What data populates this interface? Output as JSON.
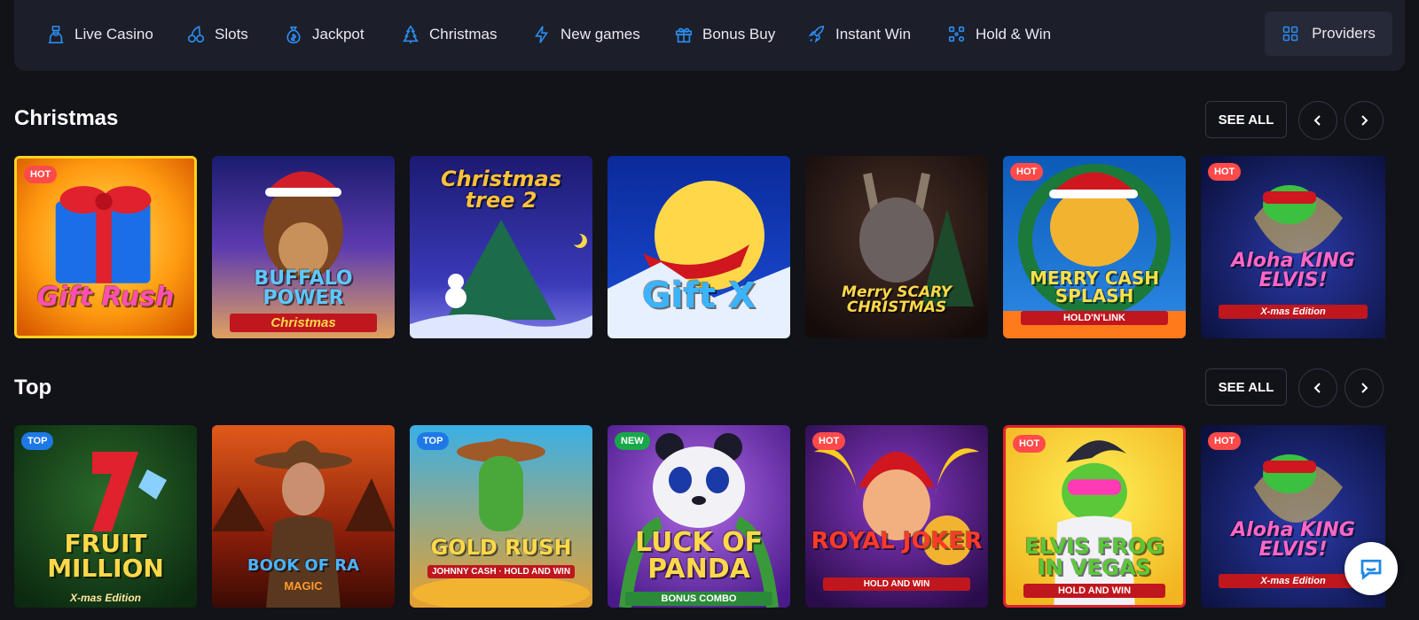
{
  "nav": {
    "items": [
      {
        "label": "Live Casino",
        "icon": "dealer-icon"
      },
      {
        "label": "Slots",
        "icon": "cherries-icon"
      },
      {
        "label": "Jackpot",
        "icon": "money-bag-icon"
      },
      {
        "label": "Christmas",
        "icon": "christmas-tree-icon"
      },
      {
        "label": "New games",
        "icon": "lightning-icon"
      },
      {
        "label": "Bonus Buy",
        "icon": "gift-icon"
      },
      {
        "label": "Instant Win",
        "icon": "rocket-icon"
      },
      {
        "label": "Hold & Win",
        "icon": "grid-dots-icon"
      }
    ],
    "providers_label": "Providers"
  },
  "colors": {
    "accent": "#1e88e5",
    "background": "#121219",
    "nav_bg": "#1c1e29",
    "hot": "#ff4a4a",
    "top": "#1e78e6",
    "new": "#18a84a"
  },
  "sections": [
    {
      "title": "Christmas",
      "see_all": "SEE ALL",
      "games": [
        {
          "title": "Gift Rush",
          "subtitle": "",
          "badge": "HOT"
        },
        {
          "title": "BUFFALO POWER",
          "subtitle": "Christmas",
          "badge": ""
        },
        {
          "title": "Christmas tree 2",
          "subtitle": "",
          "badge": ""
        },
        {
          "title": "Gift X",
          "subtitle": "",
          "badge": ""
        },
        {
          "title": "Merry SCARY CHRISTMAS",
          "subtitle": "",
          "badge": ""
        },
        {
          "title": "MERRY CASH SPLASH",
          "subtitle": "HOLD'N'LINK",
          "badge": "HOT"
        },
        {
          "title": "Aloha KING ELVIS!",
          "subtitle": "X-mas Edition",
          "badge": "HOT"
        }
      ]
    },
    {
      "title": "Top",
      "see_all": "SEE ALL",
      "games": [
        {
          "title": "FRUIT MILLION",
          "subtitle": "X-mas Edition",
          "badge": "TOP"
        },
        {
          "title": "BOOK OF RA",
          "subtitle": "MAGIC",
          "badge": ""
        },
        {
          "title": "GOLD RUSH",
          "subtitle": "JOHNNY CASH · HOLD AND WIN",
          "badge": "TOP"
        },
        {
          "title": "LUCK OF PANDA",
          "subtitle": "BONUS COMBO",
          "badge": "NEW"
        },
        {
          "title": "ROYAL JOKER",
          "subtitle": "HOLD AND WIN",
          "badge": "HOT"
        },
        {
          "title": "ELVIS FROG IN VEGAS",
          "subtitle": "HOLD AND WIN",
          "badge": "HOT"
        },
        {
          "title": "Aloha KING ELVIS!",
          "subtitle": "X-mas Edition",
          "badge": "HOT"
        }
      ]
    }
  ]
}
